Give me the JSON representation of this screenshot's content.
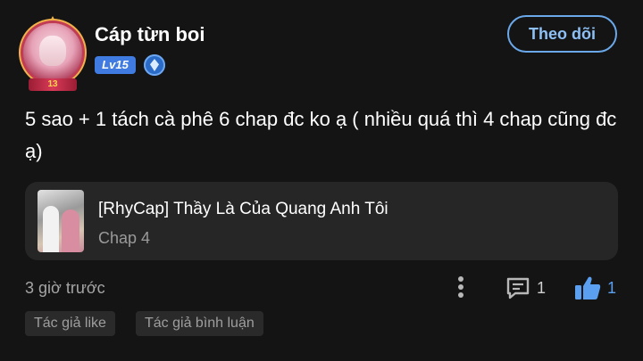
{
  "user": {
    "name": "Cáp từn boi",
    "level": "Lv15",
    "avatar_ribbon": "13",
    "follow_label": "Theo dõi"
  },
  "comment": {
    "text": "5 sao + 1 tách cà phê 6 chap đc ko ạ ( nhiều quá thì 4 chap cũng đc ạ)"
  },
  "manga": {
    "title": "[RhyCap] Thầy Là Của Quang Anh Tôi",
    "chapter": "Chap 4"
  },
  "footer": {
    "time": "3 giờ trước",
    "reply_count": "1",
    "like_count": "1"
  },
  "tags": [
    "Tác giả like",
    "Tác giả bình luận"
  ],
  "colors": {
    "background": "#141414",
    "accent": "#6aa8ea",
    "like": "#5b9ff0",
    "level_badge": "#3f7be0",
    "card": "#262626"
  },
  "icons": {
    "more": "more-vertical-icon",
    "reply": "comment-icon",
    "like": "thumbs-up-icon",
    "rank": "rank-gem-icon"
  }
}
